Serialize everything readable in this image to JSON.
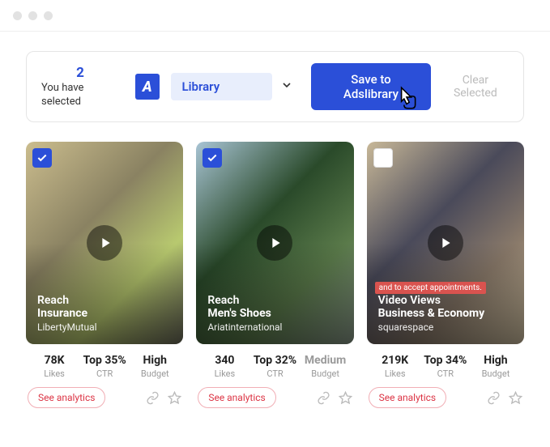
{
  "toolbar": {
    "selected_count": "2",
    "selected_label": "You have selected",
    "dropdown_value": "Library",
    "save_label": "Save to Adslibrary",
    "clear_label": "Clear Selected"
  },
  "labels": {
    "likes": "Likes",
    "ctr": "CTR",
    "budget": "Budget",
    "see_analytics": "See analytics"
  },
  "cards": [
    {
      "checked": true,
      "objective": "Reach",
      "category": "Insurance",
      "advertiser": "LibertyMutual",
      "likes": "78K",
      "ctr": "Top 35%",
      "budget": "High",
      "budget_muted": false
    },
    {
      "checked": true,
      "objective": "Reach",
      "category": "Men's Shoes",
      "advertiser": "Ariatinternational",
      "likes": "340",
      "ctr": "Top 32%",
      "budget": "Medium",
      "budget_muted": true
    },
    {
      "checked": false,
      "objective": "Video Views",
      "category": "Business & Economy",
      "advertiser": "squarespace",
      "likes": "219K",
      "ctr": "Top 34%",
      "budget": "High",
      "budget_muted": false,
      "overlay_text": "and to accept appointments."
    }
  ]
}
